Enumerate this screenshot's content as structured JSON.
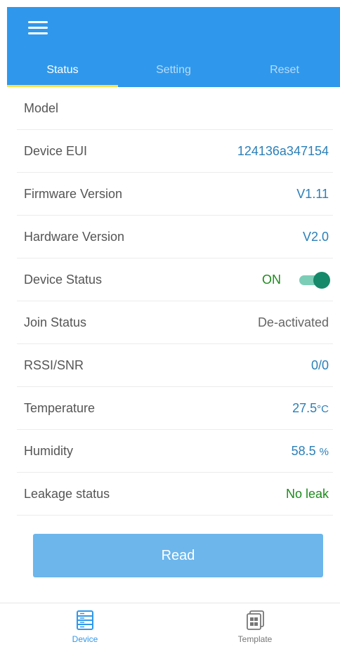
{
  "header": {
    "tabs": [
      {
        "label": "Status"
      },
      {
        "label": "Setting"
      },
      {
        "label": "Reset"
      }
    ]
  },
  "status": {
    "rows": [
      {
        "label": "Model",
        "value": ""
      },
      {
        "label": "Device EUI",
        "value": "124136a347154"
      },
      {
        "label": "Firmware Version",
        "value": "V1.11"
      },
      {
        "label": "Hardware Version",
        "value": "V2.0"
      },
      {
        "label": "Device Status",
        "value": "ON",
        "toggle_on": true
      },
      {
        "label": "Join Status",
        "value": "De-activated"
      },
      {
        "label": "RSSI/SNR",
        "value": "0/0"
      },
      {
        "label": "Temperature",
        "value": "27.5",
        "unit": "°C"
      },
      {
        "label": "Humidity",
        "value": "58.5",
        "unit": "%"
      },
      {
        "label": "Leakage status",
        "value": "No leak"
      }
    ]
  },
  "actions": {
    "read_label": "Read"
  },
  "bottom_nav": {
    "items": [
      {
        "label": "Device",
        "icon": "device-icon",
        "active": true
      },
      {
        "label": "Template",
        "icon": "template-icon",
        "active": false
      }
    ]
  },
  "colors": {
    "header": "#2f98ec",
    "tab_indicator": "#ffe14d",
    "value_blue": "#2b7fb8",
    "value_green": "#1e8a1e",
    "toggle_knob": "#16896a",
    "read_button": "#6cb6ec"
  }
}
